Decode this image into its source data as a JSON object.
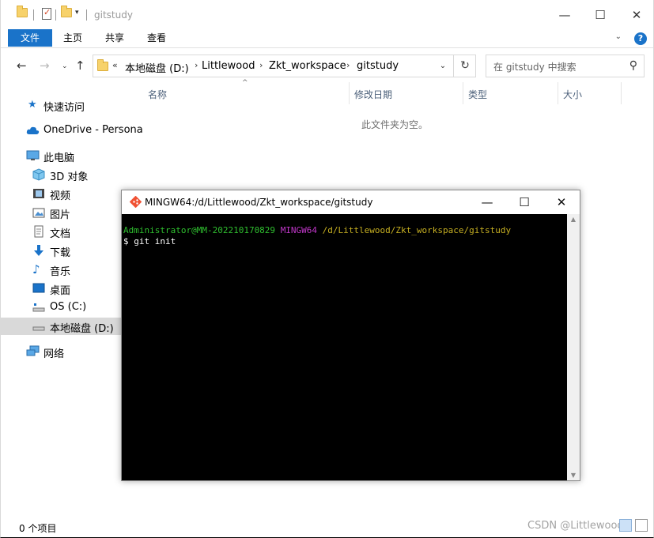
{
  "explorer": {
    "title": "gitstudy",
    "window_controls": {
      "minimize": "—",
      "maximize": "☐",
      "close": "✕"
    },
    "ribbon": {
      "tabs": [
        "文件",
        "主页",
        "共享",
        "查看"
      ],
      "help": "?"
    },
    "address": {
      "prefix": "«",
      "crumbs": [
        "本地磁盘 (D:)",
        "Littlewood",
        "Zkt_workspace",
        "gitstudy"
      ],
      "separator": "›"
    },
    "search": {
      "placeholder": "在 gitstudy 中搜索"
    },
    "sidebar": [
      {
        "label": "快速访问",
        "icon": "star-icon"
      },
      {
        "label": "OneDrive - Persona",
        "icon": "cloud-icon"
      },
      {
        "label": "此电脑",
        "icon": "computer-icon"
      },
      {
        "label": "3D 对象",
        "icon": "cube-icon"
      },
      {
        "label": "视频",
        "icon": "film-icon"
      },
      {
        "label": "图片",
        "icon": "picture-icon"
      },
      {
        "label": "文档",
        "icon": "document-icon"
      },
      {
        "label": "下载",
        "icon": "download-icon"
      },
      {
        "label": "音乐",
        "icon": "music-icon"
      },
      {
        "label": "桌面",
        "icon": "desktop-icon"
      },
      {
        "label": "OS (C:)",
        "icon": "drive-icon"
      },
      {
        "label": "本地磁盘 (D:)",
        "icon": "drive-icon"
      },
      {
        "label": "网络",
        "icon": "network-icon"
      }
    ],
    "columns": [
      "名称",
      "修改日期",
      "类型",
      "大小"
    ],
    "empty_message": "此文件夹为空。",
    "status": "0 个项目",
    "watermark": "CSDN @Littlewood"
  },
  "terminal": {
    "title": "MINGW64:/d/Littlewood/Zkt_workspace/gitstudy",
    "prompt_user": "Administrator@MM-202210170829",
    "prompt_system": "MINGW64",
    "prompt_path": "/d/Littlewood/Zkt_workspace/gitstudy",
    "command": "$ git init",
    "window_controls": {
      "minimize": "—",
      "maximize": "☐",
      "close": "✕"
    }
  },
  "colors": {
    "accent": "#1a73c9",
    "terminal_user": "#2fbf2f",
    "terminal_system": "#c037c9",
    "terminal_path": "#c7b022"
  }
}
